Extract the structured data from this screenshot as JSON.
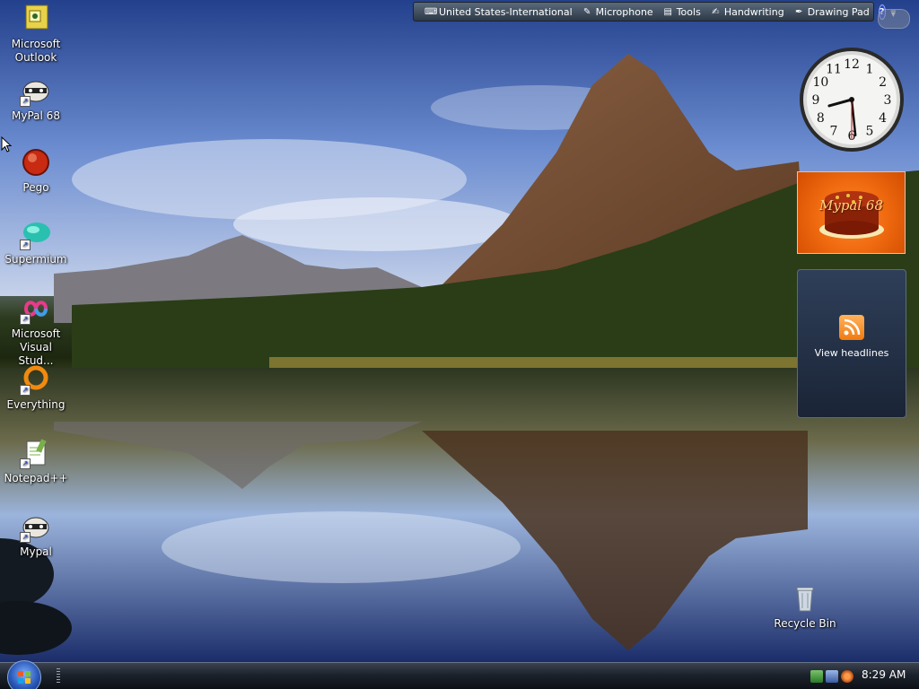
{
  "language_bar": {
    "items": [
      {
        "icon": "keyboard-icon",
        "label": "United States-International"
      },
      {
        "icon": "microphone-icon",
        "label": "Microphone"
      },
      {
        "icon": "tools-icon",
        "label": "Tools"
      },
      {
        "icon": "handwriting-icon",
        "label": "Handwriting"
      },
      {
        "icon": "drawing-pad-icon",
        "label": "Drawing Pad"
      }
    ],
    "help_glyph": "?"
  },
  "desktop_icons": [
    {
      "label_line1": "Microsoft",
      "label_line2": "Outlook",
      "icon": "outlook-icon"
    },
    {
      "label_line1": "MyPal 68",
      "label_line2": "",
      "icon": "mypal-icon"
    },
    {
      "label_line1": "Pego",
      "label_line2": "",
      "icon": "pego-icon"
    },
    {
      "label_line1": "Supermium",
      "label_line2": "",
      "icon": "supermium-icon"
    },
    {
      "label_line1": "Microsoft",
      "label_line2": "Visual Stud...",
      "icon": "visual-studio-icon"
    },
    {
      "label_line1": "Everything",
      "label_line2": "",
      "icon": "everything-icon"
    },
    {
      "label_line1": "Notepad++",
      "label_line2": "",
      "icon": "notepadpp-icon"
    },
    {
      "label_line1": "Mypal",
      "label_line2": "",
      "icon": "mypal-icon"
    }
  ],
  "recycle_bin": {
    "label": "Recycle Bin",
    "icon": "recycle-bin-icon"
  },
  "gadgets": {
    "clock": {
      "hour": 8,
      "minute": 29,
      "second": 30
    },
    "slideshow": {
      "caption": "Mypal 68"
    },
    "feeds": {
      "label": "View headlines",
      "icon": "rss-icon"
    }
  },
  "clock_numerals": [
    "12",
    "1",
    "2",
    "3",
    "4",
    "5",
    "6",
    "7",
    "8",
    "9",
    "10",
    "11"
  ],
  "taskbar": {
    "start_icon": "windows-start-icon",
    "tray_icons": [
      "network-icon",
      "speaker-icon",
      "search-icon"
    ],
    "time": "8:29 AM"
  },
  "colors": {
    "taskbar": "#1d232c",
    "language_bar": "#3c4a5a",
    "feeds_gadget": "#22304a",
    "slideshow_bg": "#f06a10"
  }
}
